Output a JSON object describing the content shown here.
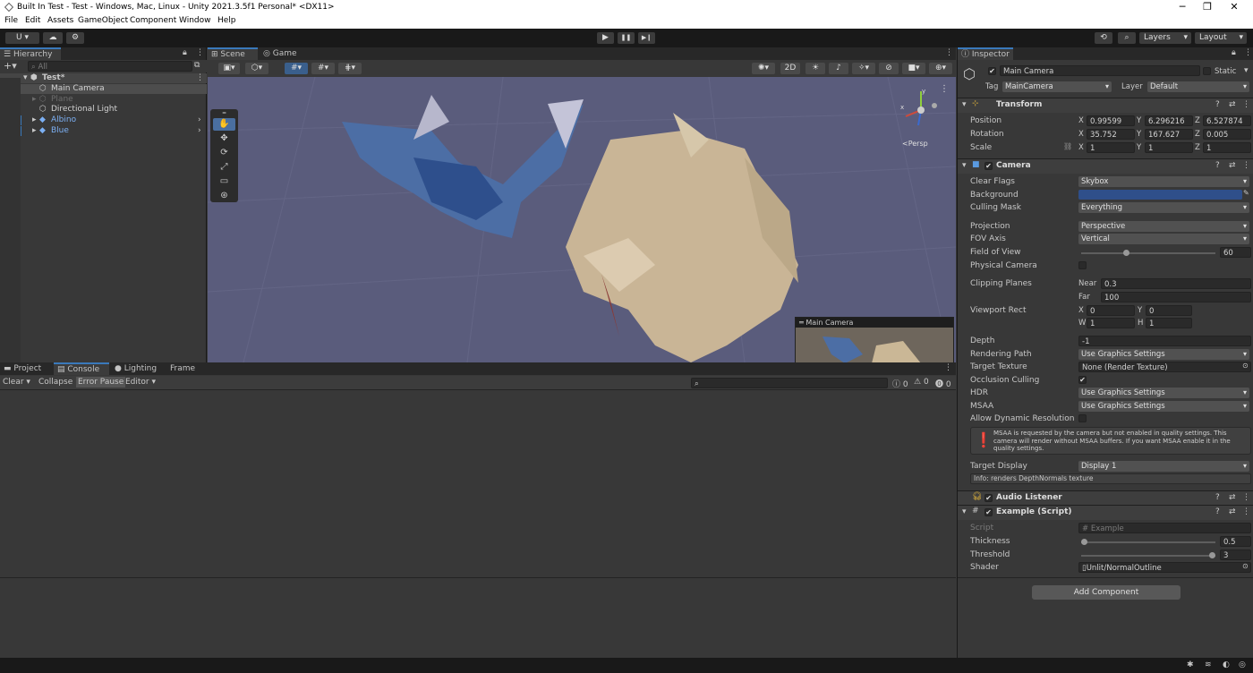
{
  "window": {
    "title": "Built In Test - Test - Windows, Mac, Linux - Unity 2021.3.5f1 Personal* <DX11>",
    "minimize": "─",
    "maximize": "❐",
    "close": "✕"
  },
  "menu": [
    "File",
    "Edit",
    "Assets",
    "GameObject",
    "Component",
    "Window",
    "Help"
  ],
  "toolbar": {
    "account": "U ▾",
    "layers": "Layers",
    "layout": "Layout",
    "play": "▶",
    "pause": "❚❚",
    "step": "▶❙"
  },
  "hierarchy": {
    "tab": "Hierarchy",
    "search_placeholder": "All",
    "scene": "Test*",
    "items": [
      {
        "label": "Main Camera",
        "color": "#d2d2d2"
      },
      {
        "label": "Plane",
        "color": "#6d6d6d"
      },
      {
        "label": "Directional Light",
        "color": "#d2d2d2"
      },
      {
        "label": "Albino",
        "color": "#7cb0f4"
      },
      {
        "label": "Blue",
        "color": "#7cb0f4"
      }
    ]
  },
  "scene": {
    "tabs": [
      "Scene",
      "Game"
    ],
    "two_d": "2D",
    "persp": "<Persp",
    "axis_y": "y",
    "axis_x": "x",
    "preview_title": "Main Camera"
  },
  "console": {
    "tabs": [
      "Project",
      "Console",
      "Lighting",
      "Frame Debug"
    ],
    "clear": "Clear",
    "collapse": "Collapse",
    "error_pause": "Error Pause",
    "editor": "Editor",
    "counts": [
      "0",
      "0",
      "0"
    ]
  },
  "inspector": {
    "tab": "Inspector",
    "object_name": "Main Camera",
    "static_label": "Static",
    "tag_label": "Tag",
    "tag_value": "MainCamera",
    "layer_label": "Layer",
    "layer_value": "Default",
    "transform": {
      "title": "Transform",
      "position": {
        "label": "Position",
        "x": "0.99599",
        "y": "6.296216",
        "z": "6.527874"
      },
      "rotation": {
        "label": "Rotation",
        "x": "35.752",
        "y": "167.627",
        "z": "0.005"
      },
      "scale": {
        "label": "Scale",
        "x": "1",
        "y": "1",
        "z": "1"
      }
    },
    "camera": {
      "title": "Camera",
      "clear_flags": {
        "label": "Clear Flags",
        "value": "Skybox"
      },
      "background": {
        "label": "Background",
        "color": "#2f4f8a"
      },
      "culling_mask": {
        "label": "Culling Mask",
        "value": "Everything"
      },
      "projection": {
        "label": "Projection",
        "value": "Perspective"
      },
      "fov_axis": {
        "label": "FOV Axis",
        "value": "Vertical"
      },
      "fov": {
        "label": "Field of View",
        "value": "60",
        "fraction": 0.33
      },
      "physical": {
        "label": "Physical Camera"
      },
      "clipping": {
        "label": "Clipping Planes",
        "near_label": "Near",
        "near": "0.3",
        "far_label": "Far",
        "far": "100"
      },
      "viewport": {
        "label": "Viewport Rect",
        "x": "0",
        "y": "0",
        "w": "1",
        "h": "1"
      },
      "depth": {
        "label": "Depth",
        "value": "-1"
      },
      "rendering_path": {
        "label": "Rendering Path",
        "value": "Use Graphics Settings"
      },
      "target_texture": {
        "label": "Target Texture",
        "value": "None (Render Texture)"
      },
      "occlusion": {
        "label": "Occlusion Culling"
      },
      "hdr": {
        "label": "HDR",
        "value": "Use Graphics Settings"
      },
      "msaa": {
        "label": "MSAA",
        "value": "Use Graphics Settings"
      },
      "dynamic_res": {
        "label": "Allow Dynamic Resolution"
      },
      "warning": "MSAA is requested by the camera but not enabled in quality settings. This camera will render without MSAA buffers. If you want MSAA enable it in the quality settings.",
      "target_display": {
        "label": "Target Display",
        "value": "Display 1"
      },
      "info": "Info: renders DepthNormals texture"
    },
    "audio_listener": {
      "title": "Audio Listener"
    },
    "example": {
      "title": "Example (Script)",
      "script": {
        "label": "Script",
        "value": "Example"
      },
      "thickness": {
        "label": "Thickness",
        "value": "0.5",
        "fraction": 0.0
      },
      "threshold": {
        "label": "Threshold",
        "value": "3",
        "fraction": 1.0
      },
      "shader": {
        "label": "Shader",
        "value": "Unlit/NormalOutline"
      }
    },
    "add_component": "Add Component"
  }
}
